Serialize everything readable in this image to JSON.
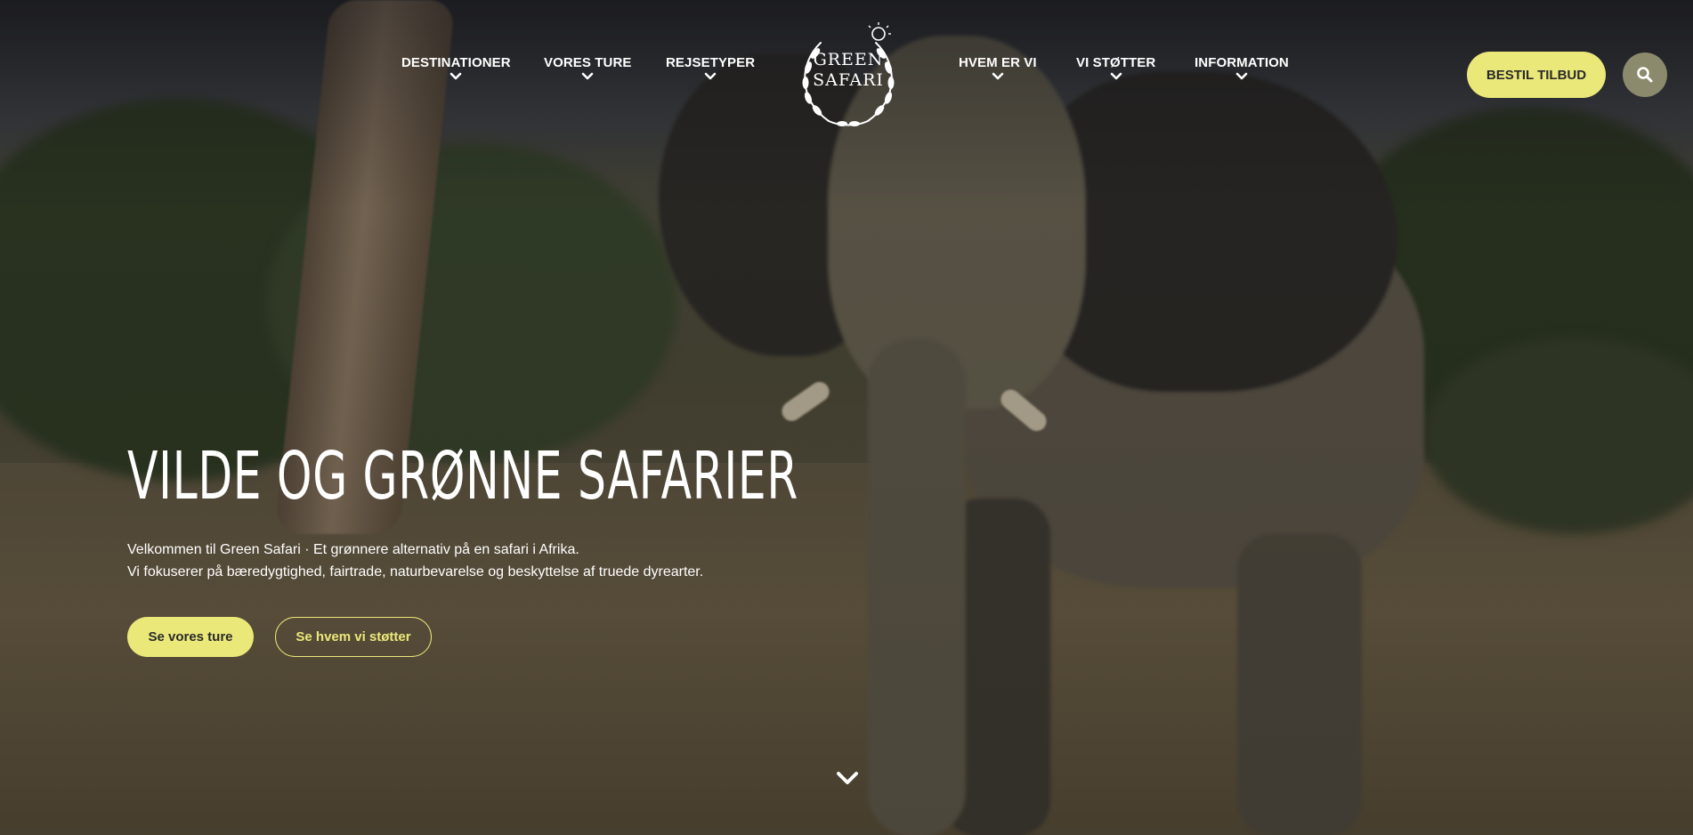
{
  "nav": {
    "left_items": [
      {
        "label": "DESTINATIONER"
      },
      {
        "label": "VORES TURE"
      },
      {
        "label": "REJSETYPER"
      }
    ],
    "right_items": [
      {
        "label": "HVEM ER VI"
      },
      {
        "label": "VI STØTTER"
      },
      {
        "label": "INFORMATION"
      }
    ],
    "logo": {
      "line1": "GREEN",
      "line2": "SAFARI"
    },
    "offer_button": "BESTIL TILBUD",
    "search_icon": "search-icon"
  },
  "hero": {
    "title": "VILDE OG GRØNNE SAFARIER",
    "intro_line1": "Velkommen til Green Safari · Et grønnere alternativ på en safari i Afrika.",
    "intro_line2": "Vi fokuserer på bæredygtighed, fairtrade, naturbevarelse og beskyttelse af truede dyrearter.",
    "primary_button": "Se vores ture",
    "secondary_button": "Se hvem vi støtter",
    "scroll_icon": "chevron-down-icon"
  },
  "colors": {
    "accent": "#ebe87a",
    "search_bg": "#8c8a6c",
    "button_text": "#2a2a2a"
  }
}
